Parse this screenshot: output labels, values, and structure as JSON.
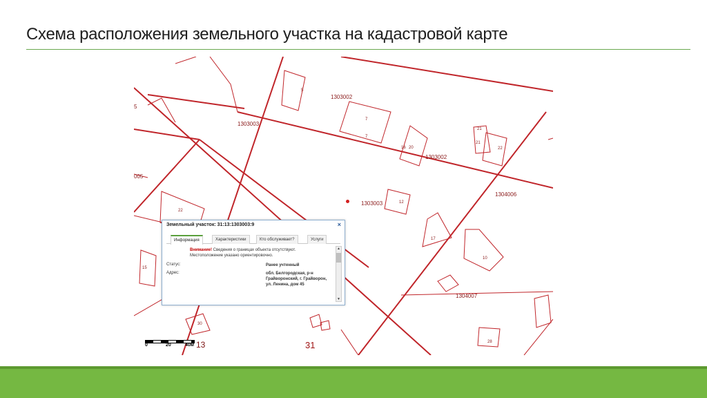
{
  "slide": {
    "title": "Схема расположения земельного участка на кадастровой карте"
  },
  "map": {
    "labels": {
      "q1303002_top": "1303002",
      "q1303003_top": "1303003",
      "q1303002_mid": "1303002",
      "q1303003_mid": "1303003",
      "q1304006": "1304006",
      "q1304007": "1304007",
      "p5": "5",
      "p7a": "7",
      "p7b": "7",
      "p16": "16",
      "p20": "20",
      "p21a": "21",
      "p21b": "21",
      "p22a": "22",
      "p22b": "22",
      "p12": "12",
      "p17": "17",
      "p10": "10",
      "p15": "15",
      "p30": "30",
      "p28": "28",
      "edge5": "5",
      "edge005": "005",
      "big31": "31",
      "big13": "13"
    },
    "scale": {
      "t0": "0",
      "t20": "20",
      "t40": "40м"
    }
  },
  "popup": {
    "title": "Земельный участок: 31:13:1303003:9",
    "close": "×",
    "tabs": [
      "Информация",
      "Характеристики",
      "Кто обслуживает?",
      "Услуги"
    ],
    "warning_label": "Внимание!",
    "warning_text": "Сведения о границах объекта отсутствуют. Местоположение указано ориентировочно.",
    "status_label": "Статус:",
    "status_value": "Ранее учтенный",
    "address_label": "Адрес:",
    "address_value": "обл. Белгородская, р-н Грайворонский, г. Грайворон, ул. Ленина, дом 45"
  },
  "colors": {
    "accent": "#75b842",
    "map_lines": "#c0252a"
  }
}
